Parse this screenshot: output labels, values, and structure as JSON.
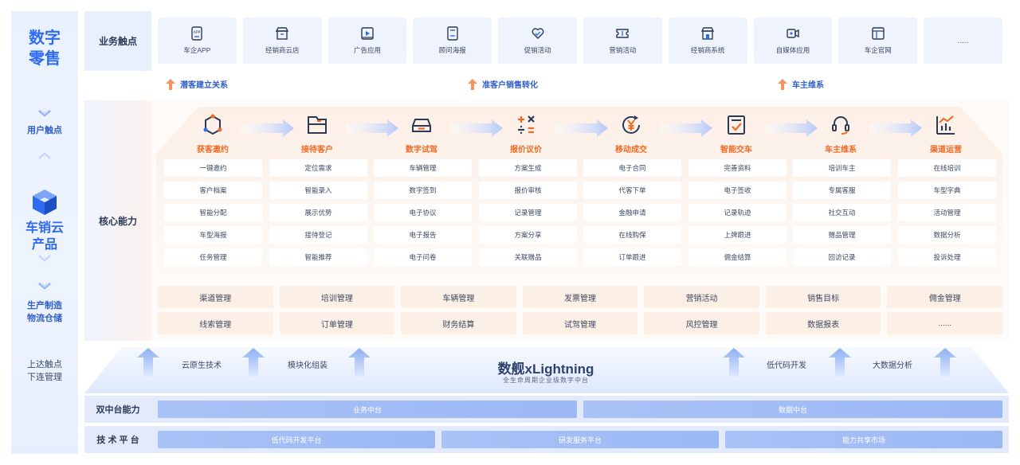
{
  "left": {
    "brand": [
      "数字",
      "零售"
    ],
    "user_touch": "用户触点",
    "cloud_product": [
      "车销云",
      "产品"
    ],
    "production": [
      "生产制造",
      "物流仓储"
    ],
    "upstream": [
      "上达触点",
      "下连管理"
    ]
  },
  "row_labels": {
    "touchpoints": "业务触点",
    "core": "核心能力",
    "dual_platform": "双中台能力",
    "tech_platform": "技 术 平 台"
  },
  "touchpoints": [
    {
      "label": "车企APP",
      "icon": "app-icon"
    },
    {
      "label": "经销商云店",
      "icon": "store-icon"
    },
    {
      "label": "广告应用",
      "icon": "ad-play-icon"
    },
    {
      "label": "顾问海报",
      "icon": "poster-icon"
    },
    {
      "label": "促销活动",
      "icon": "heart-icon"
    },
    {
      "label": "营销活动",
      "icon": "ticket-icon"
    },
    {
      "label": "经销商系统",
      "icon": "store-system-icon"
    },
    {
      "label": "自媒体应用",
      "icon": "camera-icon"
    },
    {
      "label": "车企官网",
      "icon": "website-icon"
    },
    {
      "label": "......",
      "icon": ""
    }
  ],
  "stage_notes": [
    "潜客建立关系",
    "准客户销售转化",
    "车主维系"
  ],
  "steps": [
    {
      "title": "获客邀约",
      "icon": "network-icon"
    },
    {
      "title": "接待客户",
      "icon": "folder-icon"
    },
    {
      "title": "数字试驾",
      "icon": "car-icon"
    },
    {
      "title": "报价议价",
      "icon": "calculator-icon"
    },
    {
      "title": "移动成交",
      "icon": "yen-refresh-icon"
    },
    {
      "title": "智能交车",
      "icon": "clipboard-check-icon"
    },
    {
      "title": "车主维系",
      "icon": "headset-icon"
    },
    {
      "title": "渠道运营",
      "icon": "bar-chart-icon"
    }
  ],
  "features": [
    [
      "一键邀约",
      "客户档案",
      "智能分配",
      "车型海报",
      "任务管理"
    ],
    [
      "定位需求",
      "智能录入",
      "展示优势",
      "接待登记",
      "智能推荐"
    ],
    [
      "车辆管理",
      "数字签到",
      "电子协议",
      "电子报告",
      "电子问卷"
    ],
    [
      "方案生成",
      "报价审核",
      "记录管理",
      "方案分享",
      "关联赠品"
    ],
    [
      "电子合同",
      "代客下单",
      "金融申请",
      "在线购保",
      "订单跟进"
    ],
    [
      "完善资料",
      "电子签收",
      "记录轨迹",
      "上牌跟进",
      "佣金结算"
    ],
    [
      "培训车主",
      "专属客服",
      "社交互动",
      "赠品管理",
      "回访记录"
    ],
    [
      "在线培训",
      "车型字典",
      "活动管理",
      "数据分析",
      "投诉处理"
    ]
  ],
  "management": [
    "渠道管理",
    "培训管理",
    "车辆管理",
    "发票管理",
    "营销活动",
    "销售目标",
    "佣金管理",
    "线索管理",
    "订单管理",
    "财务结算",
    "试驾管理",
    "风控管理",
    "数据报表",
    "......"
  ],
  "lightning": {
    "title": "数舰xLightning",
    "subtitle": "全生命周期企业级数字中台",
    "left_labels": [
      "云原生技术",
      "模块化组装"
    ],
    "right_labels": [
      "低代码开发",
      "大数据分析"
    ]
  },
  "dual_platform": [
    "业务中台",
    "数据中台"
  ],
  "tech_platform": [
    "低代码开发平台",
    "研发服务平台",
    "能力共享市场"
  ],
  "colors": {
    "accent_blue": "#2f6bf0",
    "accent_orange": "#f06a25"
  }
}
